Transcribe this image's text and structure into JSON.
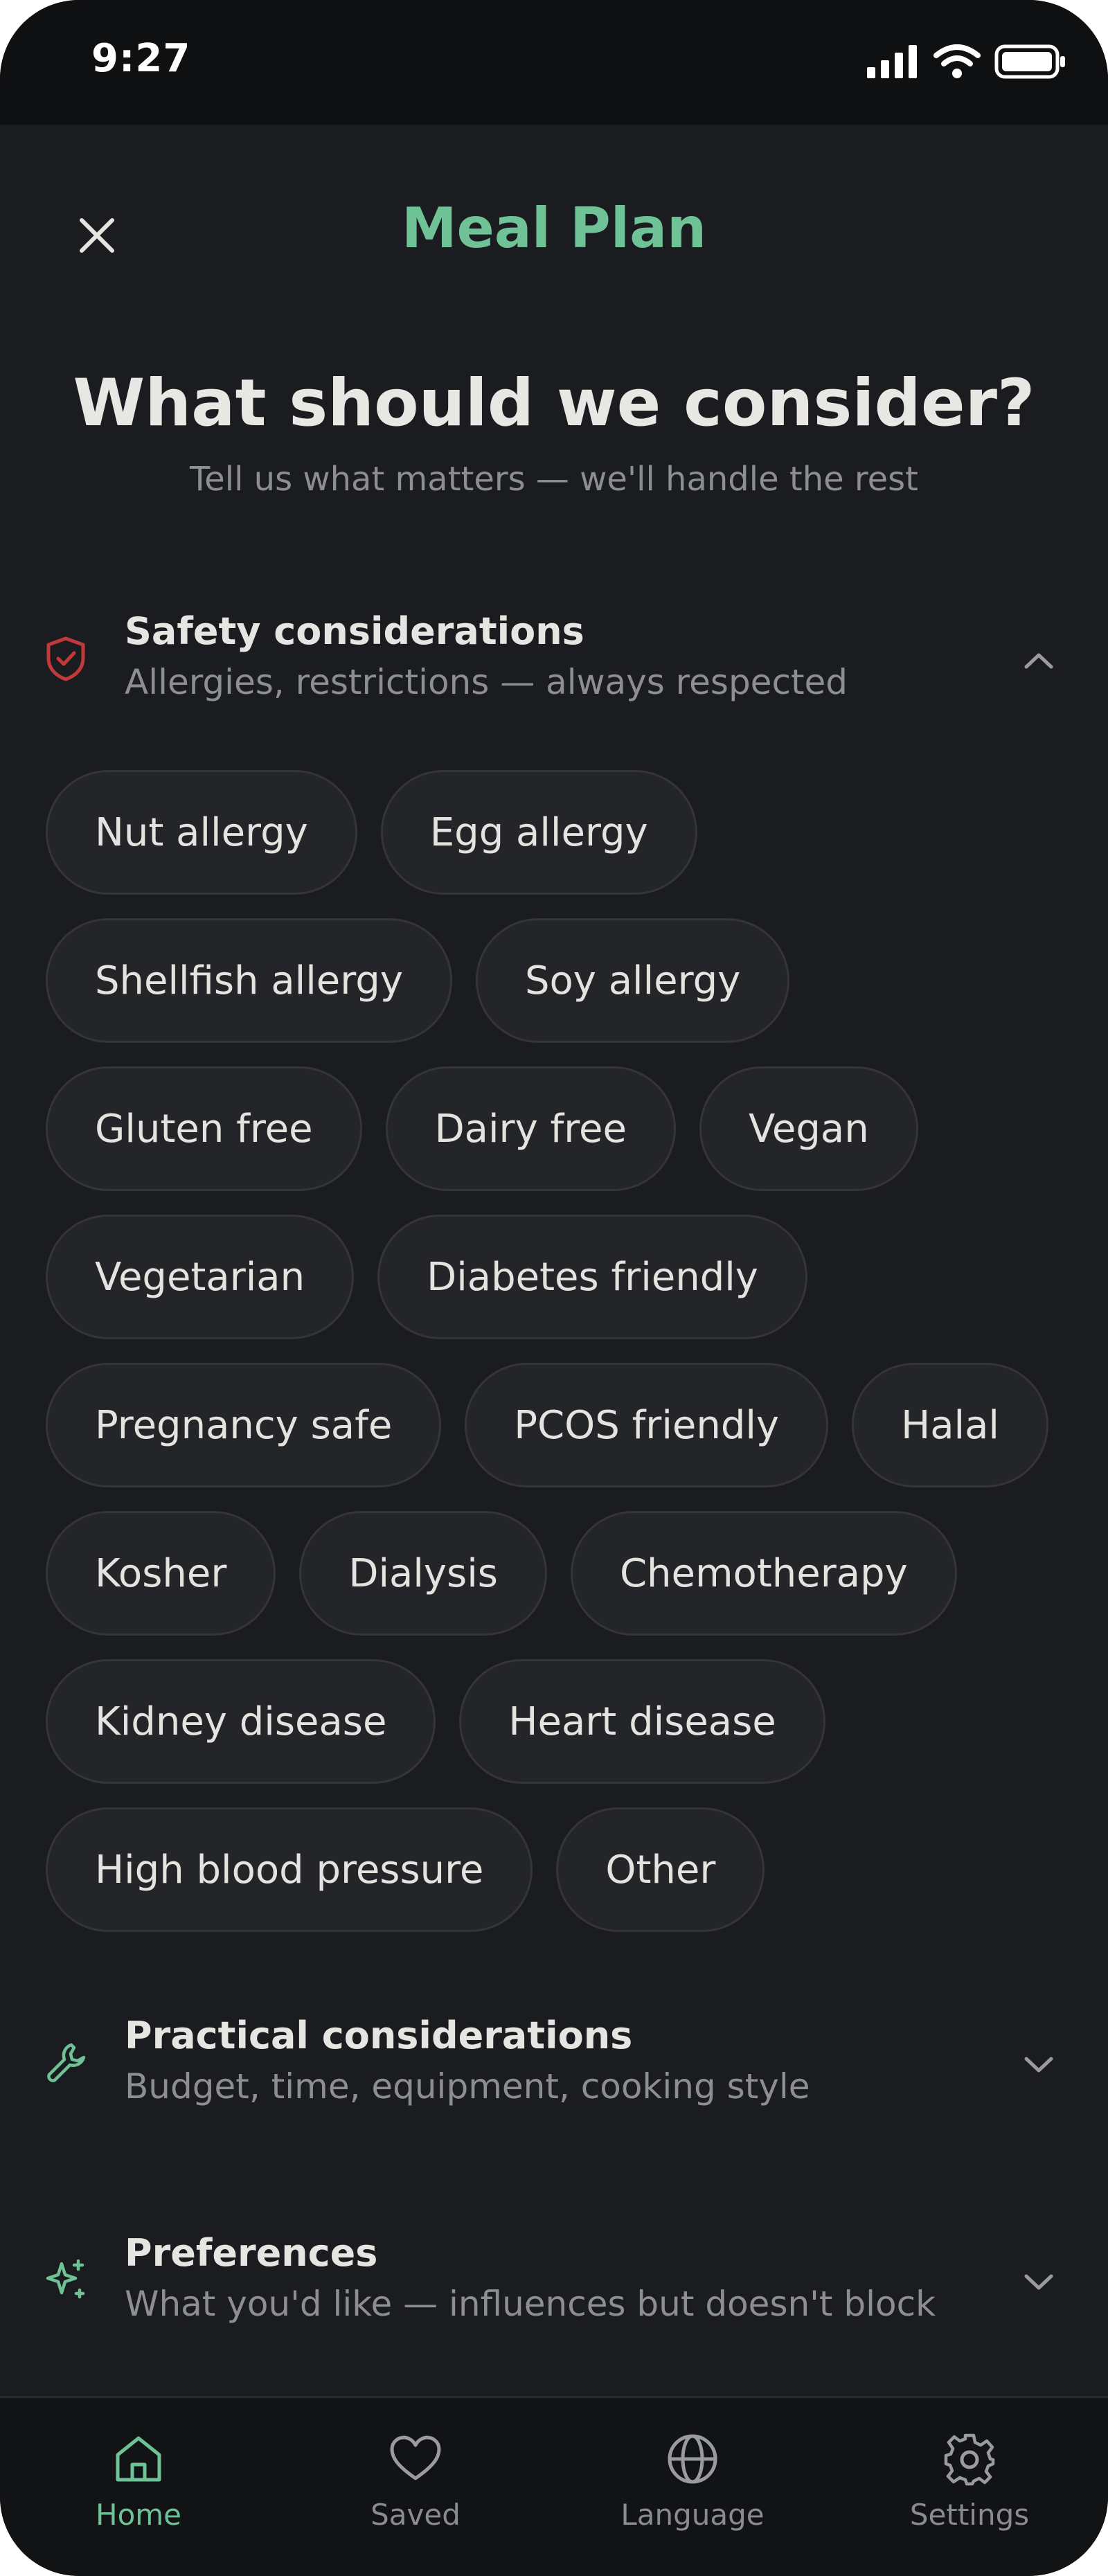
{
  "status_bar": {
    "time": "9:27"
  },
  "header": {
    "title": "Meal Plan",
    "close_icon": "close-icon"
  },
  "hero": {
    "title": "What should we consider?",
    "subtitle": "Tell us what matters — we'll handle the rest"
  },
  "sections": {
    "safety": {
      "title": "Safety considerations",
      "subtitle": "Allergies, restrictions — always respected",
      "icon": "shield-check-icon",
      "expanded": true
    },
    "practical": {
      "title": "Practical considerations",
      "subtitle": "Budget, time, equipment, cooking style",
      "icon": "wrench-icon",
      "expanded": false
    },
    "preferences": {
      "title": "Preferences",
      "subtitle": "What you'd like — influences but doesn't block",
      "icon": "sparkles-icon",
      "expanded": false
    }
  },
  "safety_options": [
    "Nut allergy",
    "Egg allergy",
    "Shellfish allergy",
    "Soy allergy",
    "Gluten free",
    "Dairy free",
    "Vegan",
    "Vegetarian",
    "Diabetes friendly",
    "Pregnancy safe",
    "PCOS friendly",
    "Halal",
    "Kosher",
    "Dialysis",
    "Chemotherapy",
    "Kidney disease",
    "Heart disease",
    "High blood pressure",
    "Other"
  ],
  "nav": {
    "items": [
      {
        "label": "Home",
        "icon": "home-icon",
        "active": true
      },
      {
        "label": "Saved",
        "icon": "heart-icon",
        "active": false
      },
      {
        "label": "Language",
        "icon": "globe-icon",
        "active": false
      },
      {
        "label": "Settings",
        "icon": "gear-icon",
        "active": false
      }
    ]
  },
  "colors": {
    "accent": "#6fc196",
    "background": "#1b1c1f",
    "chip_bg": "#242528",
    "safety_icon": "#c0393b"
  }
}
